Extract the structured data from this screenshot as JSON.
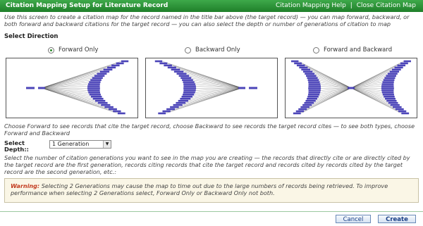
{
  "window": {
    "title": "Citation Mapping Setup for Literature Record",
    "help_link": "Citation Mapping Help",
    "separator": "|",
    "close_link": "Close Citation Map"
  },
  "intro_text": "Use this screen to create a citation map for the record named in the title bar above (the target record) — you can map forward, backward, or both forward and backward citations for the target record — you can also select the depth or number of generations of citation to map",
  "direction": {
    "label": "Select Direction",
    "options": [
      {
        "label": "Forward Only",
        "selected": true
      },
      {
        "label": "Backward Only",
        "selected": false
      },
      {
        "label": "Forward and Backward",
        "selected": false
      }
    ]
  },
  "direction_help": "Choose Forward to see records that cite the target record, choose Backward to see records the target record cites — to see both types, choose Forward and Backward",
  "depth": {
    "label": "Select Depth::",
    "selected": "1 Generation",
    "help": "Select the number of citation generations you want to see in the map you are creating — the records that directly cite or are directly cited by the target record are the first generation, records citing records that cite the target record and records cited by records cited by the target record are the second generation, etc.:"
  },
  "warning": {
    "label": "Warning:",
    "text": " Selecting 2 Generations may cause the map to time out due to the large numbers of records being retrieved. To improve performance when selecting 2 Generations select, Forward Only or Backward Only not both."
  },
  "buttons": {
    "cancel": "Cancel",
    "create": "Create"
  },
  "colors": {
    "title_bar": "#2e9a3a",
    "node_fill": "#4b44b8",
    "edge": "#444444"
  }
}
